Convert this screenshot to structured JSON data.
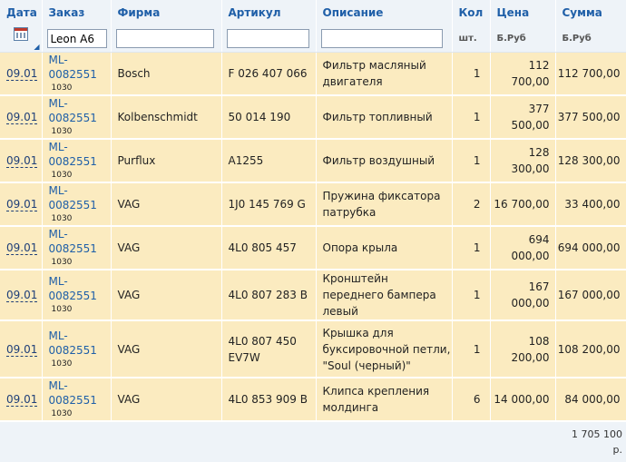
{
  "columns": {
    "date": "Дата",
    "order": "Заказ",
    "brand": "Фирма",
    "article": "Артикул",
    "description": "Описание",
    "qty": "Кол",
    "price": "Цена",
    "sum": "Сумма"
  },
  "units": {
    "qty": "шт.",
    "price": "Б.Руб",
    "sum": "Б.Руб"
  },
  "filters": {
    "order": "Leon A6",
    "brand": "",
    "article": "",
    "description": ""
  },
  "rows": [
    {
      "date": "09.01",
      "order": "ML-0082551",
      "sub": "1030",
      "brand": "Bosch",
      "article": "F 026 407 066",
      "description": "Фильтр масляный двигателя",
      "qty": "1",
      "price": "112 700,00",
      "sum": "112 700,00"
    },
    {
      "date": "09.01",
      "order": "ML-0082551",
      "sub": "1030",
      "brand": "Kolbenschmidt",
      "article": "50 014 190",
      "description": "Фильтр топливный",
      "qty": "1",
      "price": "377 500,00",
      "sum": "377 500,00"
    },
    {
      "date": "09.01",
      "order": "ML-0082551",
      "sub": "1030",
      "brand": "Purflux",
      "article": "A1255",
      "description": "Фильтр воздушный",
      "qty": "1",
      "price": "128 300,00",
      "sum": "128 300,00"
    },
    {
      "date": "09.01",
      "order": "ML-0082551",
      "sub": "1030",
      "brand": "VAG",
      "article": "1J0 145 769 G",
      "description": "Пружина фиксатора патрубка",
      "qty": "2",
      "price": "16 700,00",
      "sum": "33 400,00"
    },
    {
      "date": "09.01",
      "order": "ML-0082551",
      "sub": "1030",
      "brand": "VAG",
      "article": "4L0 805 457",
      "description": "Опора крыла",
      "qty": "1",
      "price": "694 000,00",
      "sum": "694 000,00"
    },
    {
      "date": "09.01",
      "order": "ML-0082551",
      "sub": "1030",
      "brand": "VAG",
      "article": "4L0 807 283 B",
      "description": "Кронштейн переднего бампера левый",
      "qty": "1",
      "price": "167 000,00",
      "sum": "167 000,00"
    },
    {
      "date": "09.01",
      "order": "ML-0082551",
      "sub": "1030",
      "brand": "VAG",
      "article": "4L0 807 450 EV7W",
      "description": "Крышка для буксировочной петли, \"Soul (черный)\"",
      "qty": "1",
      "price": "108 200,00",
      "sum": "108 200,00"
    },
    {
      "date": "09.01",
      "order": "ML-0082551",
      "sub": "1030",
      "brand": "VAG",
      "article": "4L0 853 909 B",
      "description": "Клипса крепления молдинга",
      "qty": "6",
      "price": "14 000,00",
      "sum": "84 000,00"
    }
  ],
  "total": {
    "amount": "1 705 100",
    "currency": "р."
  }
}
